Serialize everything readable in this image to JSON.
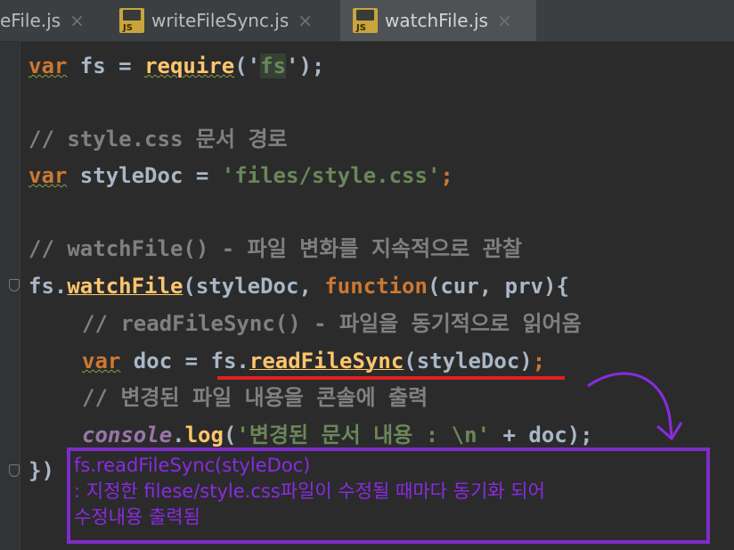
{
  "tabs": [
    {
      "label": "eFile.js",
      "close": "×",
      "icon": "",
      "active": false
    },
    {
      "label": "writeFileSync.js",
      "close": "×",
      "icon": "js-file-icon",
      "active": false
    },
    {
      "label": "watchFile.js",
      "close": "×",
      "icon": "js-file-icon",
      "active": true
    }
  ],
  "icon_text": "JS",
  "code": {
    "l1": {
      "kw": "var",
      "a": " fs = ",
      "fn": "require",
      "b": "('",
      "str": "fs",
      "c": "');"
    },
    "l2": {
      "cmt": "// style.css 문서 경로"
    },
    "l3": {
      "kw": "var",
      "a": " styleDoc = ",
      "str": "'files/style.css'",
      "b": ";"
    },
    "l4": {
      "cmt": "// watchFile() - 파일 변화를 지속적으로 관찰"
    },
    "l5": {
      "a": "fs.",
      "fn": "watchFile",
      "b": "(styleDoc, ",
      "kw": "function",
      "c": "(cur, prv){"
    },
    "l6": {
      "cmt": "// readFileSync() - 파일을 동기적으로 읽어옴"
    },
    "l7": {
      "kw": "var",
      "a": " doc = ",
      "b": "fs.",
      "fn": "readFileSync",
      "c": "(styleDoc)",
      "d": ";"
    },
    "l8": {
      "cmt": "// 변경된 파일 내용을 콘솔에 출력"
    },
    "l9": {
      "it": "console",
      "a": ".",
      "fn": "log",
      "b": "(",
      "str": "'변경된 문서 내용 : \\n'",
      "c": " + doc);"
    },
    "l10": {
      "a": "})"
    }
  },
  "annotation": {
    "line1": "fs.readFileSync(styleDoc)",
    "line2": ": 지정한 filese/style.css파일이 수정될 때마다 동기화 되어",
    "line3": "수정내용 출력됨"
  },
  "colors": {
    "annotation": "#8a2be2",
    "underline": "#e02020"
  }
}
